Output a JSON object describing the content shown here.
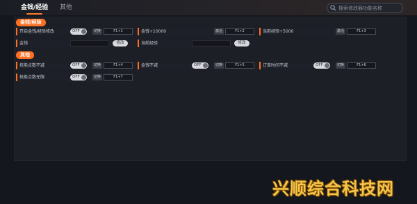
{
  "tabs": [
    {
      "label": "金钱/经验",
      "active": true
    },
    {
      "label": "其他",
      "active": false
    }
  ],
  "search": {
    "placeholder": "搜索修改器功能名称"
  },
  "sections": {
    "money_exp": {
      "title": "金钱/经验",
      "rows": [
        {
          "label": "开启金钱/经验修改",
          "control": "toggle",
          "state": "OFF",
          "action": "切换",
          "hotkey": "F1+1"
        },
        {
          "label": "金钱+10000",
          "control": "hotkey",
          "action": "激活",
          "hotkey": "F1+2"
        },
        {
          "label": "当前经验+5000",
          "control": "hotkey",
          "action": "激活",
          "hotkey": "F1+3"
        },
        {
          "label": "金钱",
          "control": "input",
          "button": "修改"
        },
        {
          "label": "当前经验",
          "control": "input",
          "button": "修改"
        }
      ]
    },
    "other": {
      "title": "其他",
      "rows": [
        {
          "label": "技能点数不减",
          "control": "toggle",
          "state": "OFF",
          "action": "切换",
          "hotkey": "F1+4"
        },
        {
          "label": "金钱不减",
          "control": "toggle",
          "state": "OFF",
          "action": "切换",
          "hotkey": "F1+5"
        },
        {
          "label": "订单时间不减",
          "control": "toggle",
          "state": "OFF",
          "action": "切换",
          "hotkey": "F1+6"
        },
        {
          "label": "技能点数无限",
          "control": "toggle",
          "state": "OFF",
          "action": "切换",
          "hotkey": "F1+7"
        }
      ]
    }
  },
  "watermark": "兴顺综合科技网",
  "colors": {
    "accent": "#ff6f22",
    "background": "#15171e",
    "panel": "#1d1f27"
  }
}
